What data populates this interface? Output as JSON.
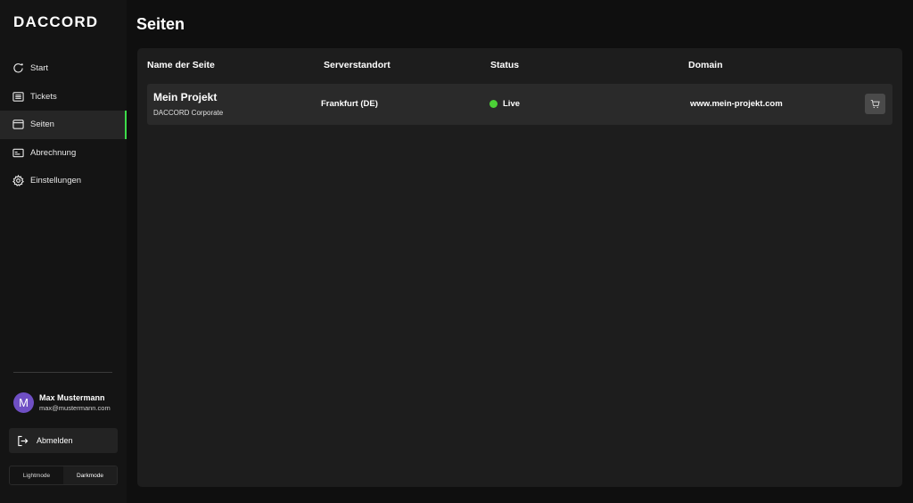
{
  "brand": {
    "logo": "DACCORD"
  },
  "sidebar": {
    "items": [
      {
        "label": "Start",
        "icon": "start-icon"
      },
      {
        "label": "Tickets",
        "icon": "tickets-icon"
      },
      {
        "label": "Seiten",
        "icon": "browser-window-icon",
        "active": true
      },
      {
        "label": "Abrechnung",
        "icon": "billing-icon"
      },
      {
        "label": "Einstellungen",
        "icon": "gear-icon"
      }
    ],
    "accent_color": "#3ddc4a"
  },
  "user": {
    "initial": "M",
    "name": "Max Mustermann",
    "email": "max@mustermann.com",
    "avatar_color": "#6f4fc4"
  },
  "logout": {
    "label": "Abmelden",
    "icon": "logout-icon"
  },
  "mode": {
    "light_label": "Lightmode",
    "dark_label": "Darkmode",
    "selected": "Darkmode"
  },
  "page": {
    "title": "Seiten"
  },
  "table": {
    "columns": [
      "Name der Seite",
      "Serverstandort",
      "Status",
      "Domain"
    ],
    "rows": [
      {
        "name": "Mein Projekt",
        "subtitle": "DACCORD Corporate",
        "location": "Frankfurt (DE)",
        "status": "Live",
        "status_color": "#4cd137",
        "domain": "www.mein-projekt.com",
        "action_icon": "cart-icon"
      }
    ]
  }
}
